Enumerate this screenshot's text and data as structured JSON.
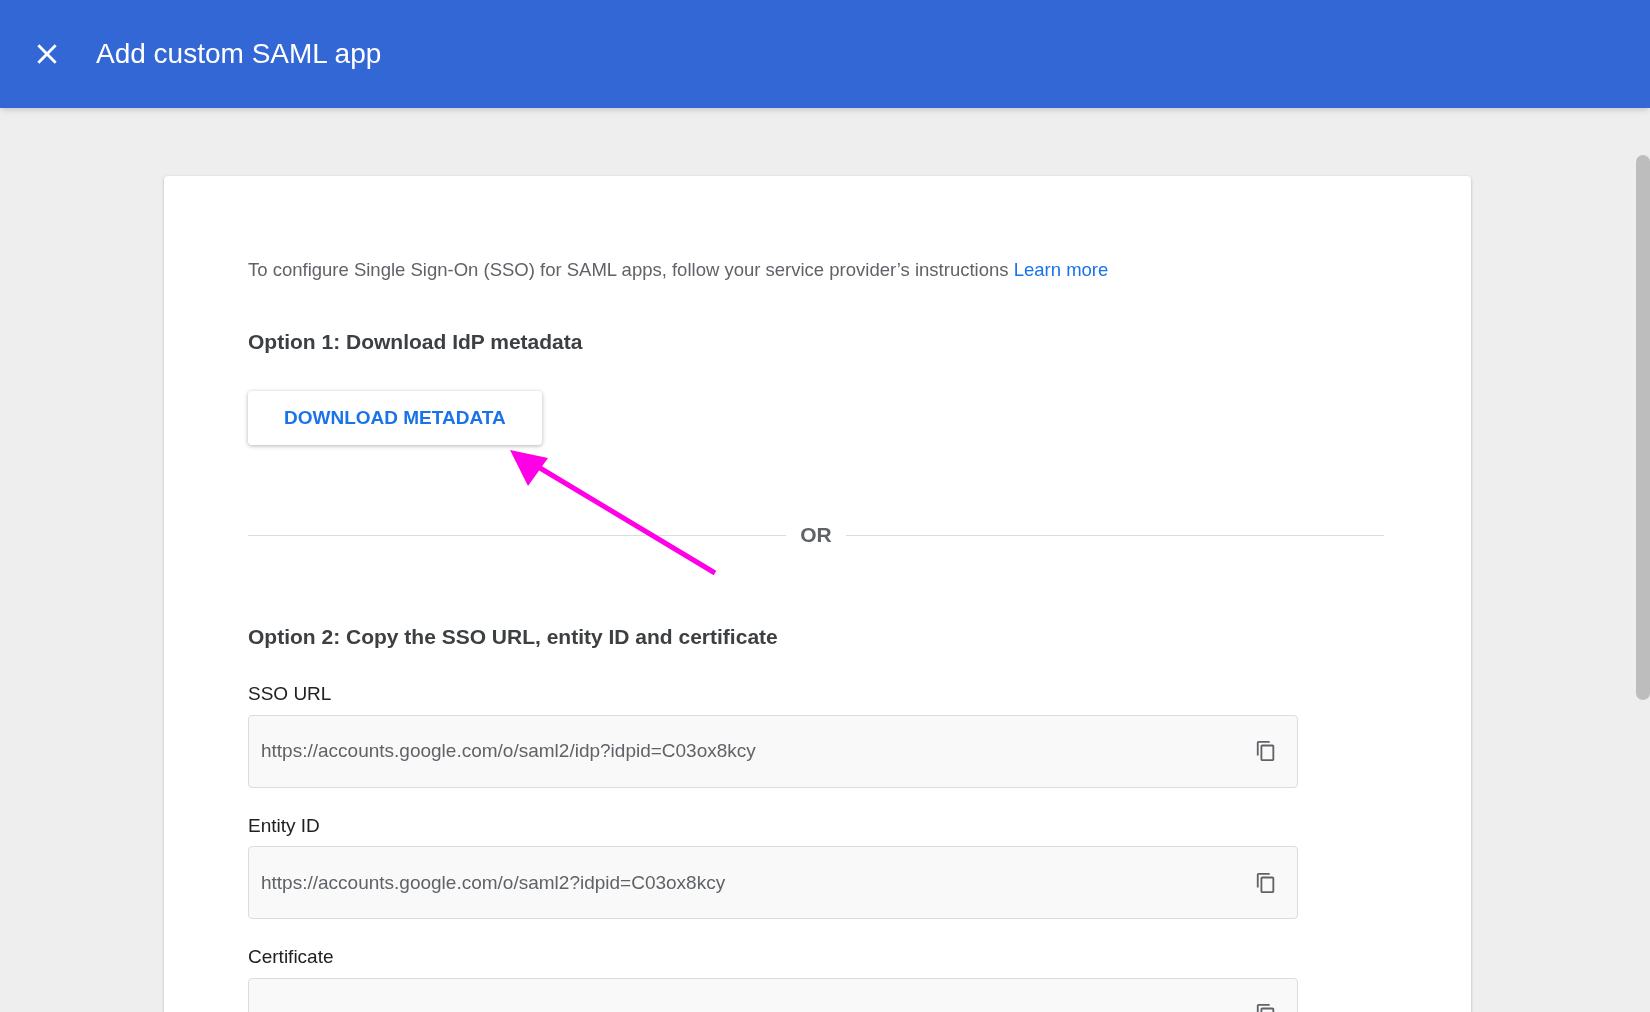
{
  "header": {
    "title": "Add custom SAML app"
  },
  "intro": {
    "text": "To configure Single Sign-On (SSO) for SAML apps, follow your service provider’s instructions",
    "link": "Learn more"
  },
  "option1": {
    "heading": "Option 1: Download IdP metadata",
    "button": "DOWNLOAD METADATA"
  },
  "divider": {
    "label": "OR"
  },
  "option2": {
    "heading": "Option 2: Copy the SSO URL, entity ID and certificate",
    "fields": [
      {
        "label": "SSO URL",
        "value": "https://accounts.google.com/o/saml2/idp?idpid=C03ox8kcy"
      },
      {
        "label": "Entity ID",
        "value": "https://accounts.google.com/o/saml2?idpid=C03ox8kcy"
      },
      {
        "label": "Certificate"
      }
    ]
  }
}
